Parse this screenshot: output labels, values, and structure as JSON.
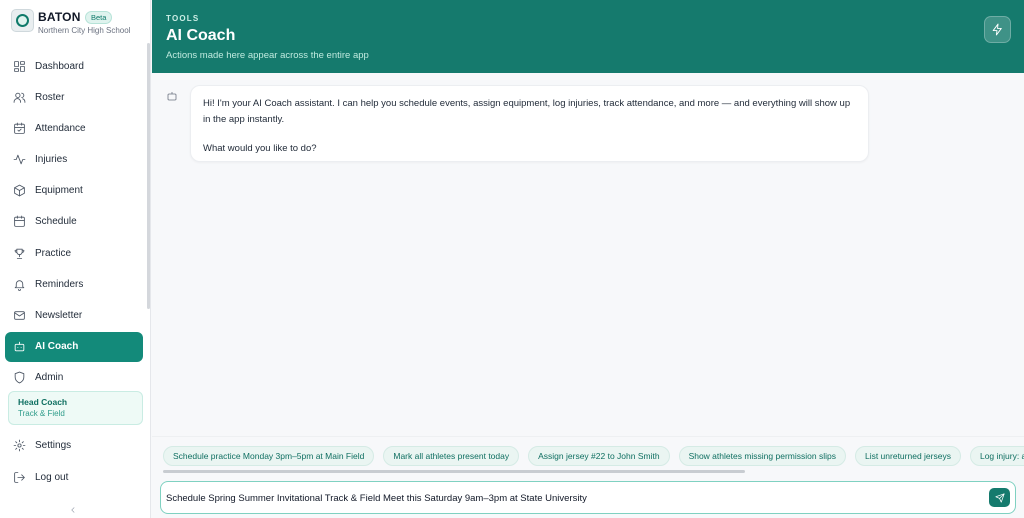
{
  "brand": {
    "name": "BATON",
    "badge": "Beta",
    "school": "Northern City High School"
  },
  "nav": [
    {
      "label": "Dashboard",
      "icon": "dashboard-icon"
    },
    {
      "label": "Roster",
      "icon": "users-icon"
    },
    {
      "label": "Attendance",
      "icon": "calendar-check-icon"
    },
    {
      "label": "Injuries",
      "icon": "activity-icon"
    },
    {
      "label": "Equipment",
      "icon": "box-icon"
    },
    {
      "label": "Schedule",
      "icon": "calendar-icon"
    },
    {
      "label": "Practice",
      "icon": "trophy-icon"
    },
    {
      "label": "Reminders",
      "icon": "bell-icon"
    },
    {
      "label": "Newsletter",
      "icon": "mail-icon"
    },
    {
      "label": "AI Coach",
      "icon": "bot-icon",
      "active": true
    },
    {
      "label": "Admin",
      "icon": "shield-icon"
    }
  ],
  "role": {
    "title": "Head Coach",
    "team": "Track & Field"
  },
  "bottom_nav": [
    {
      "label": "Settings",
      "icon": "gear-icon"
    },
    {
      "label": "Log out",
      "icon": "logout-icon"
    }
  ],
  "header": {
    "eyebrow": "TOOLS",
    "title": "AI Coach",
    "subtitle": "Actions made here appear across the entire app"
  },
  "chat": {
    "messages": [
      {
        "role": "assistant",
        "lines": [
          "Hi! I'm your AI Coach assistant. I can help you schedule events, assign equipment, log injuries, track attendance, and more — and everything will show up in the app instantly.",
          "What would you like to do?"
        ]
      }
    ]
  },
  "suggestions": [
    "Schedule practice Monday 3pm–5pm at Main Field",
    "Mark all athletes present today",
    "Assign jersey #22 to John Smith",
    "Show athletes missing permission slips",
    "List unreturned jerseys",
    "Log injury: a"
  ],
  "composer": {
    "value": "Schedule Spring Summer Invitational Track & Field Meet this Saturday 9am–3pm at State University"
  },
  "colors": {
    "accent": "#157a6d",
    "active_nav": "#138a7a",
    "chip_bg": "#eaf5f2"
  }
}
